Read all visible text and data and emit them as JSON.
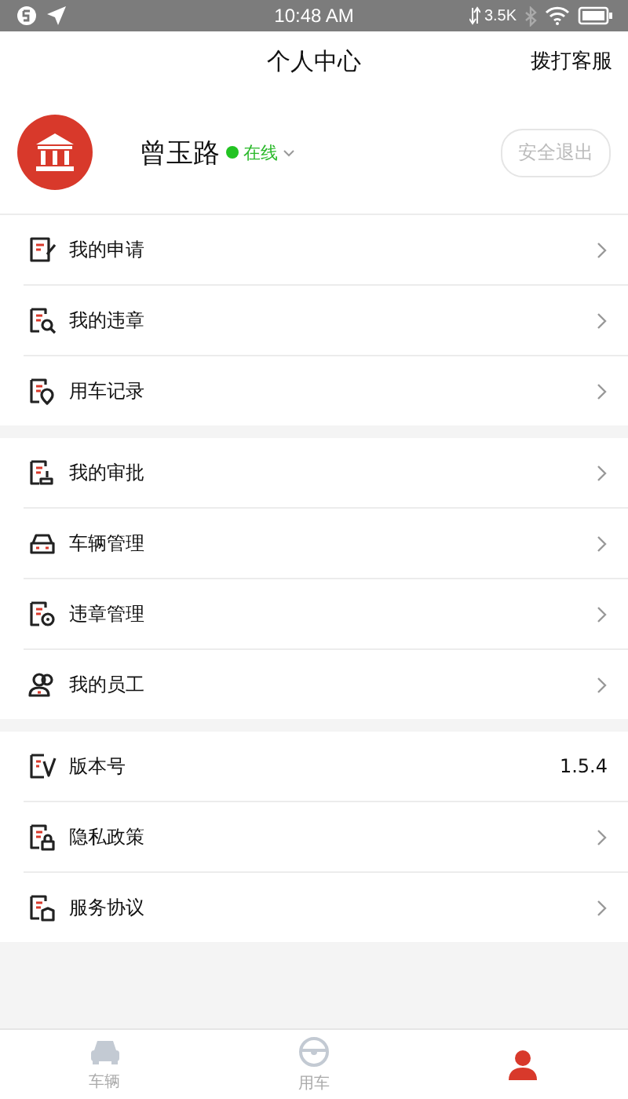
{
  "status_bar": {
    "time": "10:48 AM",
    "network_speed": "3.5K"
  },
  "header": {
    "title": "个人中心",
    "action": "拨打客服"
  },
  "profile": {
    "name": "曾玉路",
    "status": "在线",
    "logout": "安全退出"
  },
  "groups": [
    {
      "items": [
        {
          "kind": "link",
          "label": "我的申请"
        },
        {
          "kind": "link",
          "label": "我的违章"
        },
        {
          "kind": "link",
          "label": "用车记录"
        }
      ]
    },
    {
      "items": [
        {
          "kind": "link",
          "label": "我的审批"
        },
        {
          "kind": "link",
          "label": "车辆管理"
        },
        {
          "kind": "link",
          "label": "违章管理"
        },
        {
          "kind": "link",
          "label": "我的员工"
        }
      ]
    },
    {
      "items": [
        {
          "kind": "value",
          "label": "版本号",
          "value": "1.5.4"
        },
        {
          "kind": "link",
          "label": "隐私政策"
        },
        {
          "kind": "link",
          "label": "服务协议"
        }
      ]
    }
  ],
  "tabs": [
    {
      "label": "车辆",
      "selected": false
    },
    {
      "label": "用车",
      "selected": false
    },
    {
      "selected": true
    }
  ]
}
